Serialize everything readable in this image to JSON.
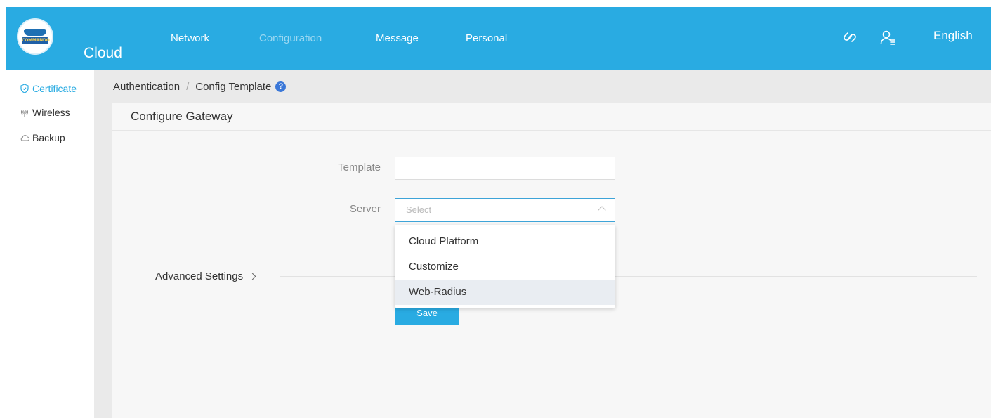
{
  "header": {
    "logo_text": "COMMANDO",
    "brand": "Cloud",
    "nav": [
      {
        "label": "Network",
        "active": false
      },
      {
        "label": "Configuration",
        "active": true
      },
      {
        "label": "Message",
        "active": false
      },
      {
        "label": "Personal",
        "active": false
      }
    ],
    "icons": [
      "link-icon",
      "user-icon"
    ],
    "language": "English",
    "color": "#29abe2"
  },
  "sidebar": {
    "items": [
      {
        "label": "Certificate",
        "icon": "shield-icon",
        "active": true
      },
      {
        "label": "Wireless",
        "icon": "wireless-icon",
        "active": false
      },
      {
        "label": "Backup",
        "icon": "cloud-icon",
        "active": false
      }
    ]
  },
  "breadcrumb": {
    "parent": "Authentication",
    "separator": "/",
    "current": "Config Template",
    "help": "?"
  },
  "panel": {
    "title": "Configure Gateway",
    "form": {
      "template_label": "Template",
      "template_value": "",
      "server_label": "Server",
      "server_placeholder": "Select",
      "server_options": [
        "Cloud Platform",
        "Customize",
        "Web-Radius"
      ],
      "hovered_option": "Web-Radius"
    },
    "advanced_label": "Advanced Settings",
    "save_label": "Save"
  }
}
